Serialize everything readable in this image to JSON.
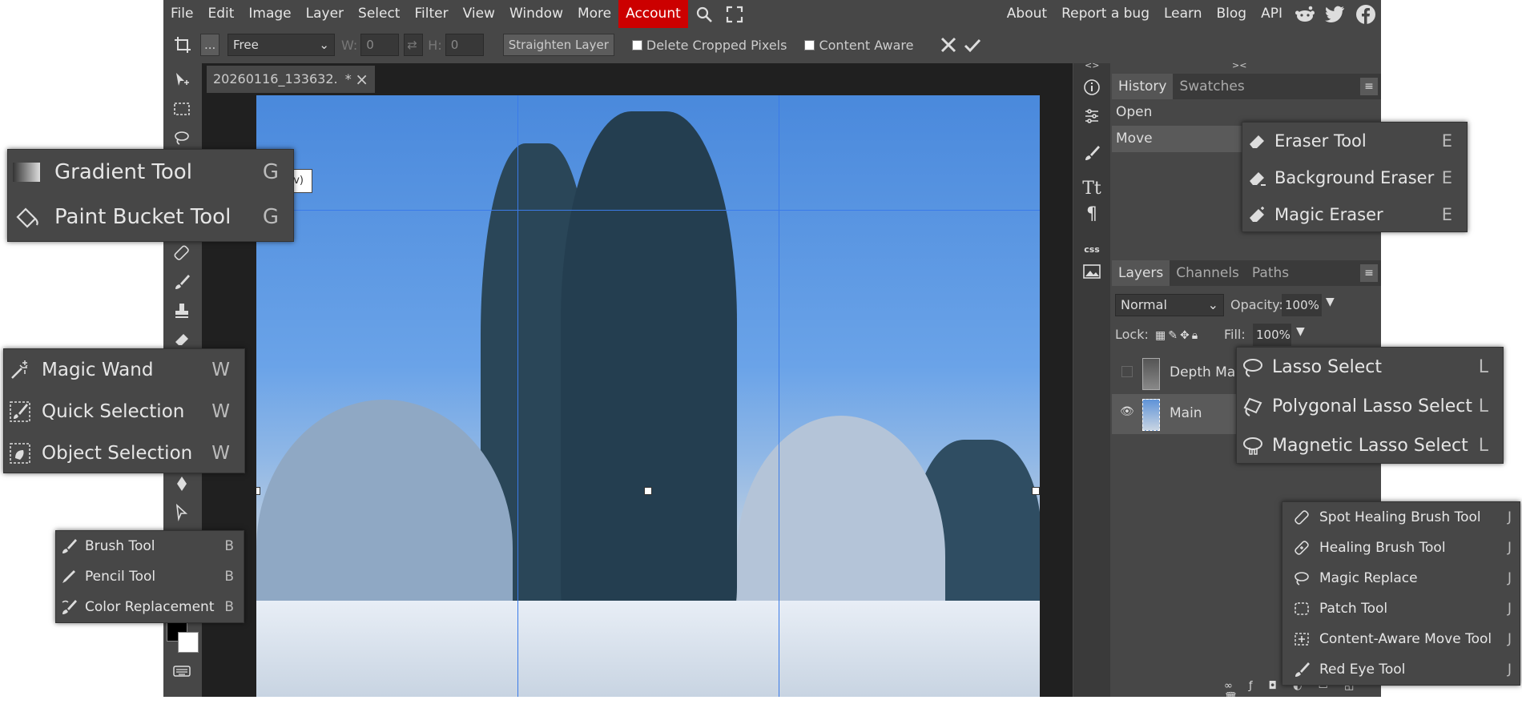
{
  "menu": {
    "items": [
      "File",
      "Edit",
      "Image",
      "Layer",
      "Select",
      "Filter",
      "View",
      "Window",
      "More"
    ],
    "account": "Account",
    "right": [
      "About",
      "Report a bug",
      "Learn",
      "Blog",
      "API"
    ]
  },
  "options": {
    "more": "...",
    "ratio": "Free",
    "w_label": "W:",
    "w_value": "0",
    "h_label": "H:",
    "h_value": "0",
    "straighten": "Straighten Layer",
    "delete_cropped": "Delete Cropped Pixels",
    "content_aware": "Content Aware"
  },
  "document": {
    "tab_title": "20260116_133632.",
    "tab_modified": "*",
    "tab_close": "×",
    "crop_label": "v)"
  },
  "history": {
    "tabs": [
      "History",
      "Swatches"
    ],
    "entries": [
      "Open",
      "Move"
    ]
  },
  "layers": {
    "tabs": [
      "Layers",
      "Channels",
      "Paths"
    ],
    "blend_mode": "Normal",
    "opacity_label": "Opacity:",
    "opacity": "100%",
    "lock_label": "Lock:",
    "fill_label": "Fill:",
    "fill": "100%",
    "rows": [
      {
        "name": "Depth Map",
        "visible": false
      },
      {
        "name": "Main",
        "visible": true
      }
    ]
  },
  "flyouts": {
    "gradient": [
      {
        "label": "Gradient Tool",
        "key": "G",
        "icon": "gradient-icon"
      },
      {
        "label": "Paint Bucket Tool",
        "key": "G",
        "icon": "paint-bucket-icon"
      }
    ],
    "wand": [
      {
        "label": "Magic Wand",
        "key": "W",
        "icon": "magic-wand-icon"
      },
      {
        "label": "Quick Selection",
        "key": "W",
        "icon": "quick-selection-icon"
      },
      {
        "label": "Object Selection",
        "key": "W",
        "icon": "object-selection-icon"
      }
    ],
    "brush": [
      {
        "label": "Brush Tool",
        "key": "B",
        "icon": "brush-icon"
      },
      {
        "label": "Pencil Tool",
        "key": "B",
        "icon": "pencil-icon"
      },
      {
        "label": "Color Replacement",
        "key": "B",
        "icon": "color-replacement-icon"
      }
    ],
    "eraser": [
      {
        "label": "Eraser Tool",
        "key": "E",
        "icon": "eraser-icon"
      },
      {
        "label": "Background Eraser",
        "key": "E",
        "icon": "background-eraser-icon"
      },
      {
        "label": "Magic Eraser",
        "key": "E",
        "icon": "magic-eraser-icon"
      }
    ],
    "lasso": [
      {
        "label": "Lasso Select",
        "key": "L",
        "icon": "lasso-icon"
      },
      {
        "label": "Polygonal Lasso Select",
        "key": "L",
        "icon": "polygonal-lasso-icon"
      },
      {
        "label": "Magnetic Lasso Select",
        "key": "L",
        "icon": "magnetic-lasso-icon"
      }
    ],
    "healing": [
      {
        "label": "Spot Healing Brush Tool",
        "key": "J",
        "icon": "spot-healing-icon"
      },
      {
        "label": "Healing Brush Tool",
        "key": "J",
        "icon": "healing-brush-icon"
      },
      {
        "label": "Magic Replace",
        "key": "J",
        "icon": "magic-replace-icon"
      },
      {
        "label": "Patch Tool",
        "key": "J",
        "icon": "patch-icon"
      },
      {
        "label": "Content-Aware Move Tool",
        "key": "J",
        "icon": "content-aware-move-icon"
      },
      {
        "label": "Red Eye Tool",
        "key": "J",
        "icon": "red-eye-icon"
      }
    ]
  },
  "colors": {
    "accent": "#cc0000",
    "panel": "#474747",
    "foreground": "#000000",
    "background": "#ffffff"
  }
}
